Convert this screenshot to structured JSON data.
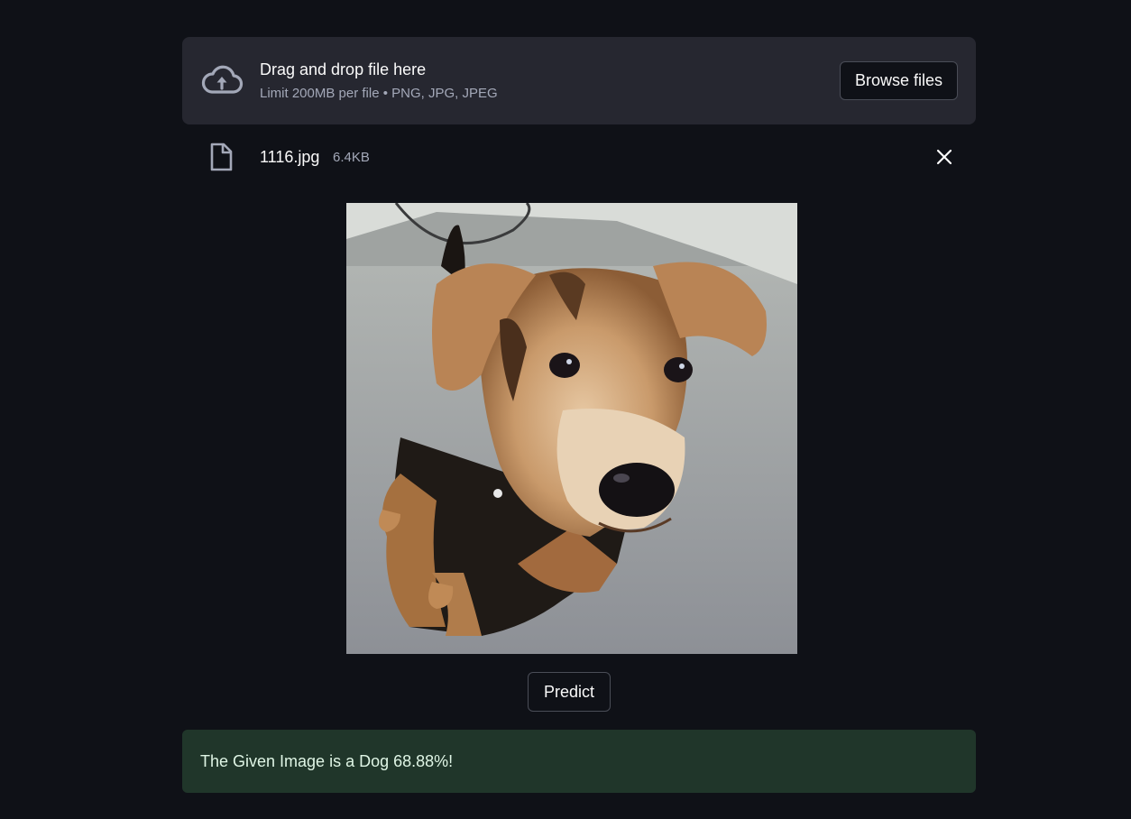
{
  "uploader": {
    "title": "Drag and drop file here",
    "limit_text": "Limit 200MB per file • PNG, JPG, JPEG",
    "browse_label": "Browse files",
    "icon": "cloud-upload-icon"
  },
  "file": {
    "name": "1116.jpg",
    "size": "6.4KB",
    "icon": "file-icon",
    "remove_icon": "close-icon"
  },
  "image": {
    "subject": "dog"
  },
  "actions": {
    "predict_label": "Predict"
  },
  "result": {
    "message": "The Given Image is a Dog 68.88%!"
  },
  "colors": {
    "background": "#0f1117",
    "panel": "#262730",
    "success_bg": "#20362a",
    "text": "#fafafa",
    "muted_text": "#a3a8b8"
  }
}
